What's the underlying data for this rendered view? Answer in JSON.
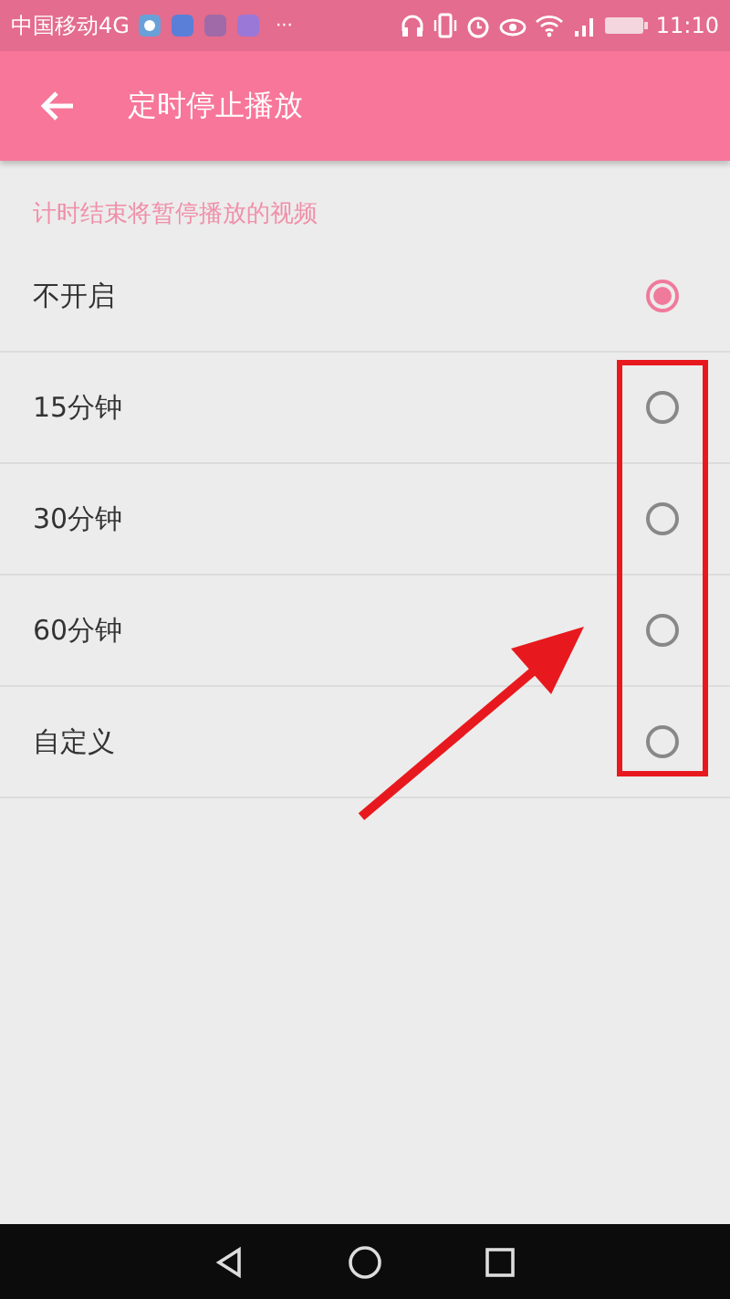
{
  "status_bar": {
    "carrier": "中国移动4G",
    "more": "···",
    "time": "11:10"
  },
  "header": {
    "title": "定时停止播放"
  },
  "hint": "计时结束将暂停播放的视频",
  "options": [
    {
      "label": "不开启",
      "selected": true
    },
    {
      "label": "15分钟",
      "selected": false
    },
    {
      "label": "30分钟",
      "selected": false
    },
    {
      "label": "60分钟",
      "selected": false
    },
    {
      "label": "自定义",
      "selected": false
    }
  ]
}
